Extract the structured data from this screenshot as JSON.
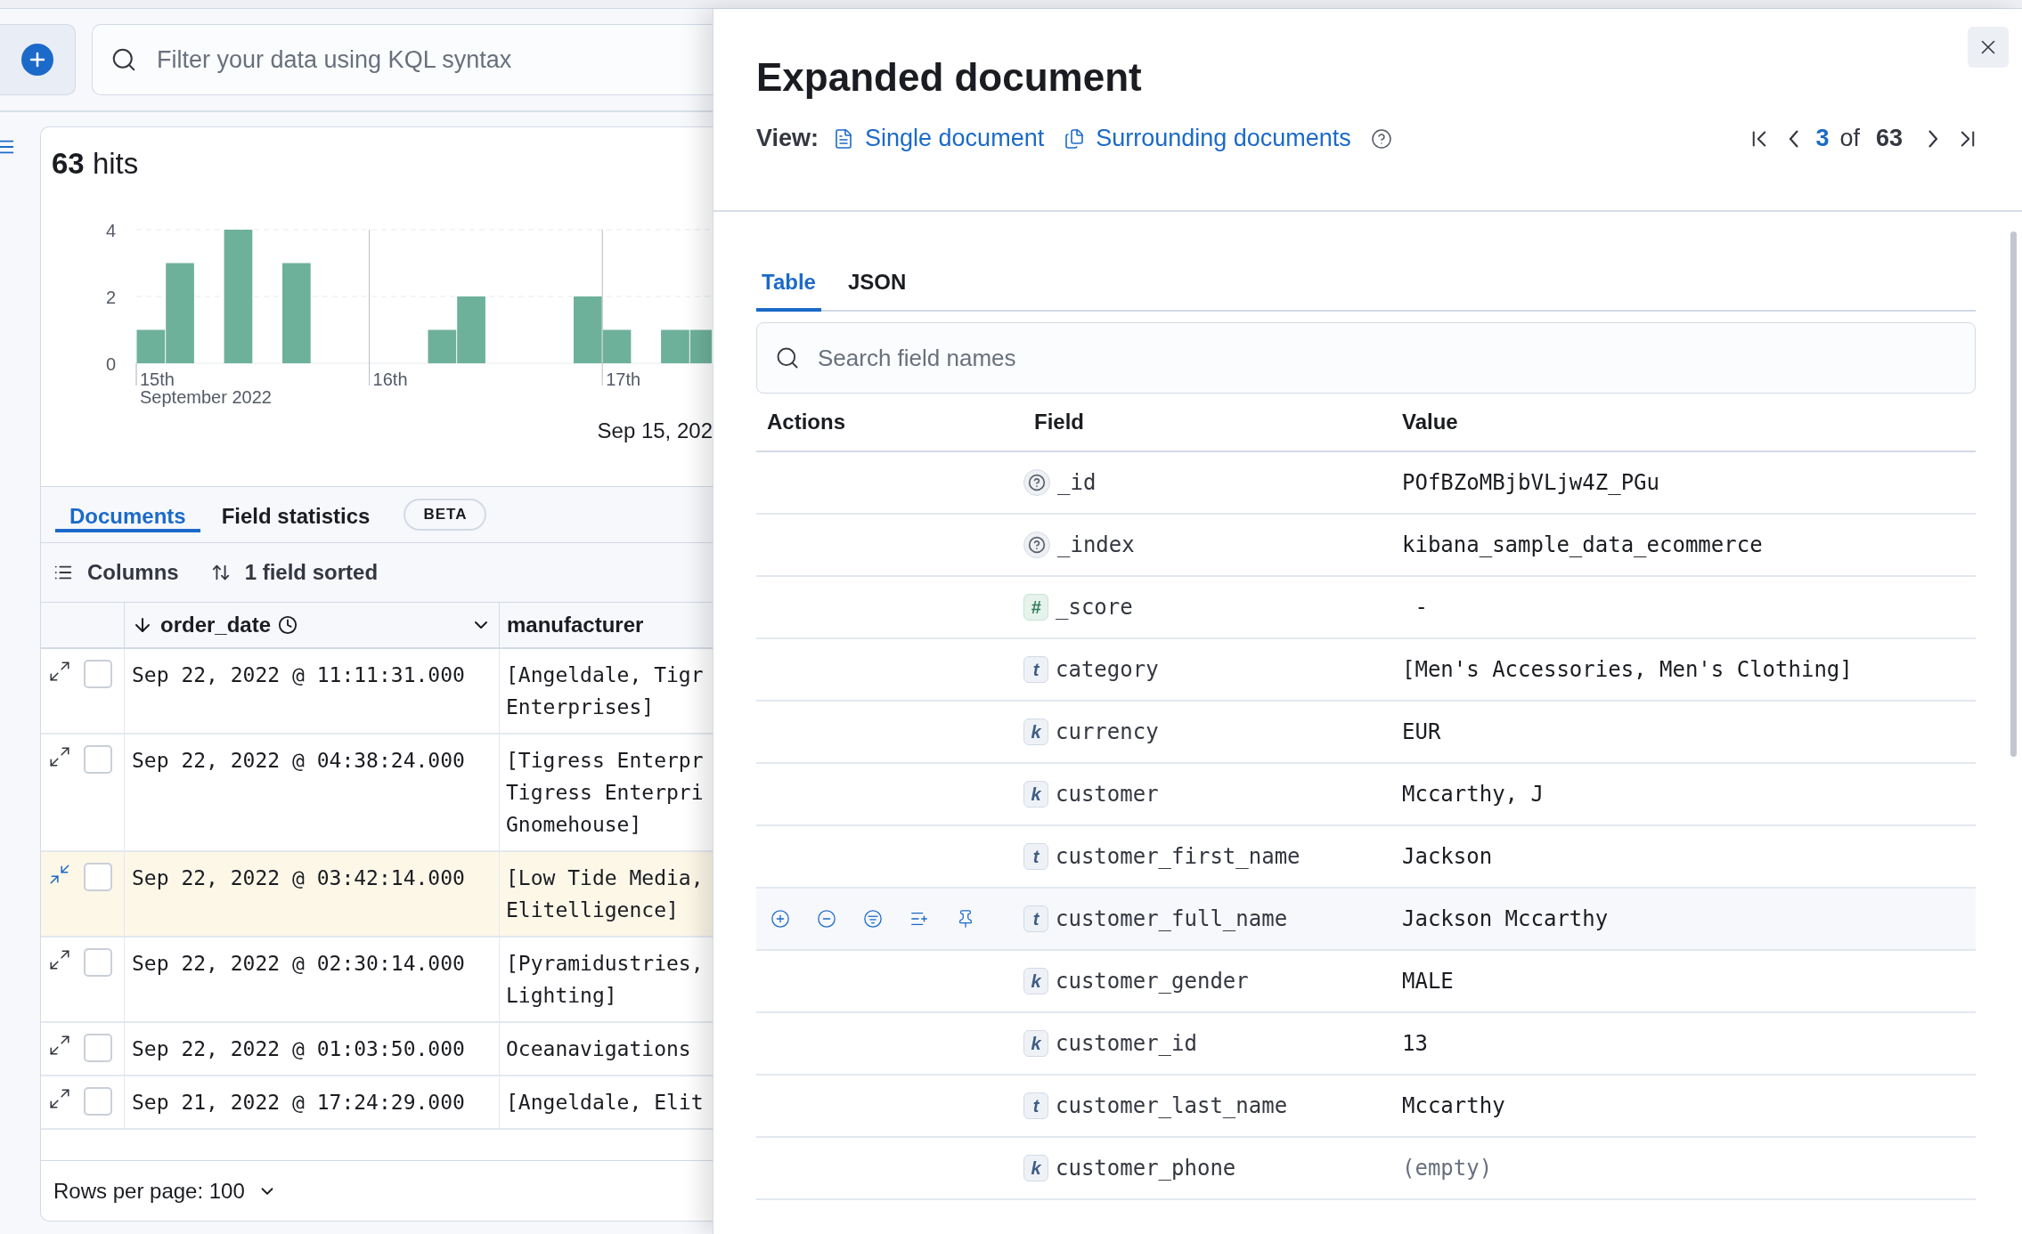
{
  "query_bar": {
    "placeholder": "Filter your data using KQL syntax"
  },
  "hits": "**63** hits",
  "histogram": {
    "date_label": "Sep 15, 202",
    "chart_data": {
      "type": "bar",
      "xlabel": "September 2022",
      "categories": [
        "15th",
        null,
        null,
        null,
        null,
        null,
        null,
        null,
        "16th",
        null,
        null,
        null,
        null,
        null,
        null,
        null,
        "17th",
        null,
        null,
        null
      ],
      "values": [
        1,
        3,
        0,
        4,
        0,
        3,
        0,
        0,
        0,
        0,
        1,
        2,
        0,
        0,
        0,
        2,
        1,
        0,
        1,
        1
      ],
      "yticks": [
        0,
        2,
        4
      ],
      "ylim": [
        0,
        4
      ]
    }
  },
  "tabs": [
    {
      "label": "Documents",
      "selected": true
    },
    {
      "label": "Field statistics",
      "selected": false,
      "badge": "BETA"
    }
  ],
  "grid_toolbar": {
    "columns_label": "Columns",
    "sort_label": "1 field sorted"
  },
  "grid": {
    "columns": [
      "order_date",
      "manufacturer"
    ],
    "rows": [
      {
        "selected": false,
        "checked": false,
        "order_date": "Sep 22, 2022 @ 11:11:31.000",
        "manufacturer": [
          "[Angeldale, Tigr",
          "Enterprises]"
        ]
      },
      {
        "selected": false,
        "checked": false,
        "order_date": "Sep 22, 2022 @ 04:38:24.000",
        "manufacturer": [
          "[Tigress Enterpr",
          "Tigress Enterpri",
          "Gnomehouse]"
        ]
      },
      {
        "selected": true,
        "checked": false,
        "order_date": "Sep 22, 2022 @ 03:42:14.000",
        "manufacturer": [
          "[Low Tide Media,",
          "Elitelligence]"
        ]
      },
      {
        "selected": false,
        "checked": false,
        "order_date": "Sep 22, 2022 @ 02:30:14.000",
        "manufacturer": [
          "[Pyramidustries,",
          "Lighting]"
        ]
      },
      {
        "selected": false,
        "checked": false,
        "order_date": "Sep 22, 2022 @ 01:03:50.000",
        "manufacturer": [
          "Oceanavigations"
        ]
      },
      {
        "selected": false,
        "checked": false,
        "order_date": "Sep 21, 2022 @ 17:24:29.000",
        "manufacturer": [
          "[Angeldale, Elit"
        ]
      }
    ]
  },
  "footer": {
    "rows_per_page": "Rows per page: 100"
  },
  "flyout": {
    "title": "Expanded document",
    "view_label": "View:",
    "view_links": [
      {
        "kind": "single",
        "label": "Single document"
      },
      {
        "kind": "surrounding",
        "label": "Surrounding documents"
      }
    ],
    "pagination": {
      "current": "3",
      "of": "of",
      "total": "63"
    },
    "tabs": [
      {
        "label": "Table",
        "selected": true
      },
      {
        "label": "JSON",
        "selected": false
      }
    ],
    "search": {
      "placeholder": "Search field names"
    },
    "table": {
      "columns": [
        "Actions",
        "Field",
        "Value"
      ],
      "rows": [
        {
          "kind": "unknown",
          "field": "_id",
          "value": "POfBZoMBjbVLjw4Z_PGu",
          "hovered": false,
          "muted": false
        },
        {
          "kind": "unknown",
          "field": "_index",
          "value": "kibana_sample_data_ecommerce",
          "hovered": false,
          "muted": false
        },
        {
          "kind": "number",
          "badge": "#",
          "field": "_score",
          "value": " -",
          "hovered": false,
          "muted": false
        },
        {
          "kind": "text",
          "badge": "t",
          "field": "category",
          "value": "[Men's Accessories, Men's Clothing]",
          "hovered": false,
          "muted": false
        },
        {
          "kind": "keyword",
          "badge": "k",
          "field": "currency",
          "value": "EUR",
          "hovered": false,
          "muted": false
        },
        {
          "kind": "keyword",
          "badge": "k",
          "field": "customer",
          "value": "Mccarthy, J",
          "hovered": false,
          "muted": false
        },
        {
          "kind": "text",
          "badge": "t",
          "field": "customer_first_name",
          "value": "Jackson",
          "hovered": false,
          "muted": false
        },
        {
          "kind": "text",
          "badge": "t",
          "field": "customer_full_name",
          "value": "Jackson Mccarthy",
          "hovered": true,
          "muted": false
        },
        {
          "kind": "keyword",
          "badge": "k",
          "field": "customer_gender",
          "value": "MALE",
          "hovered": false,
          "muted": false
        },
        {
          "kind": "keyword",
          "badge": "k",
          "field": "customer_id",
          "value": "13",
          "hovered": false,
          "muted": false
        },
        {
          "kind": "text",
          "badge": "t",
          "field": "customer_last_name",
          "value": "Mccarthy",
          "hovered": false,
          "muted": false
        },
        {
          "kind": "keyword",
          "badge": "k",
          "field": "customer_phone",
          "value": "(empty)",
          "hovered": false,
          "muted": true
        }
      ]
    }
  }
}
